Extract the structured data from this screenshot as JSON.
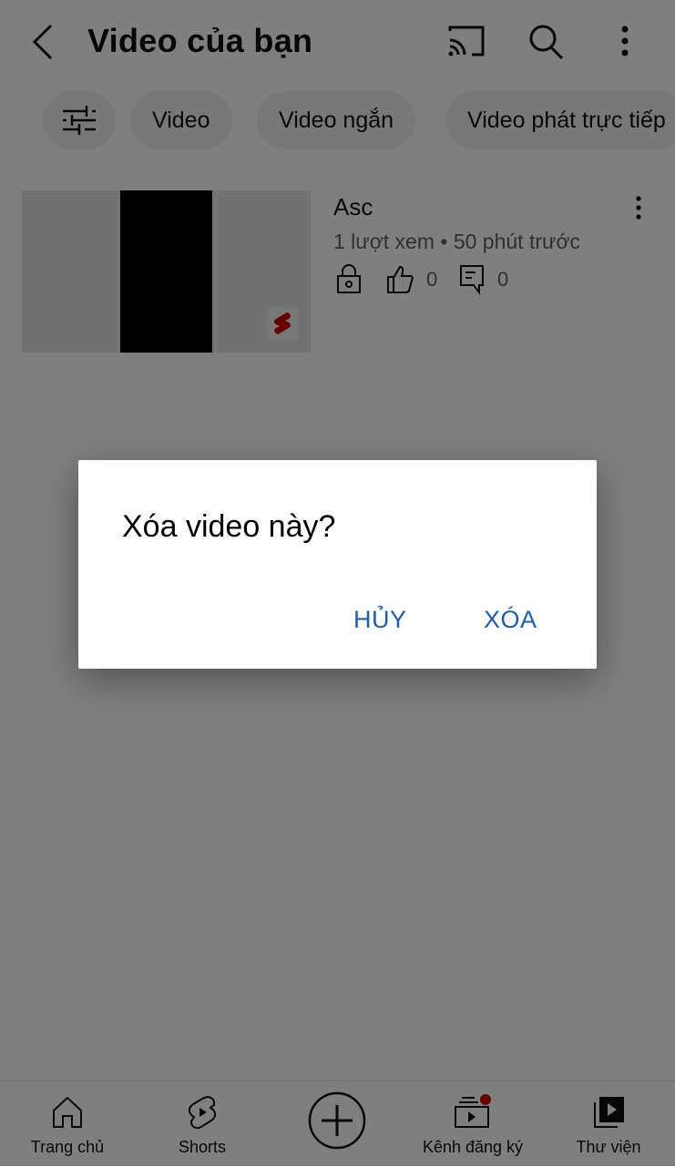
{
  "header": {
    "title": "Video của bạn",
    "icons": [
      "back-icon",
      "cast-icon",
      "search-icon",
      "more-vert-icon"
    ]
  },
  "chips": {
    "filter_icon": "filter-icon",
    "items": [
      {
        "label": "Video"
      },
      {
        "label": "Video ngắn"
      },
      {
        "label": "Video phát trực tiếp"
      }
    ]
  },
  "video": {
    "title": "Asc",
    "meta": "1 lượt xem • 50 phút trước",
    "likes": "0",
    "comments": "0",
    "badge_icon": "shorts-logo-icon",
    "privacy_icon": "lock-icon"
  },
  "bottom_nav": {
    "items": [
      {
        "label": "Trang chủ",
        "icon": "home-icon"
      },
      {
        "label": "Shorts",
        "icon": "shorts-icon"
      },
      {
        "label": "",
        "icon": "create-icon"
      },
      {
        "label": "Kênh đăng ký",
        "icon": "subscriptions-icon",
        "badge": true
      },
      {
        "label": "Thư viện",
        "icon": "library-icon"
      }
    ]
  },
  "dialog": {
    "title": "Xóa video này?",
    "cancel_label": "HỦY",
    "delete_label": "XÓA"
  },
  "colors": {
    "accent_blue": "#1a5fb4",
    "badge_red": "#cc0000",
    "scrim": "rgba(0,0,0,0.5)"
  }
}
